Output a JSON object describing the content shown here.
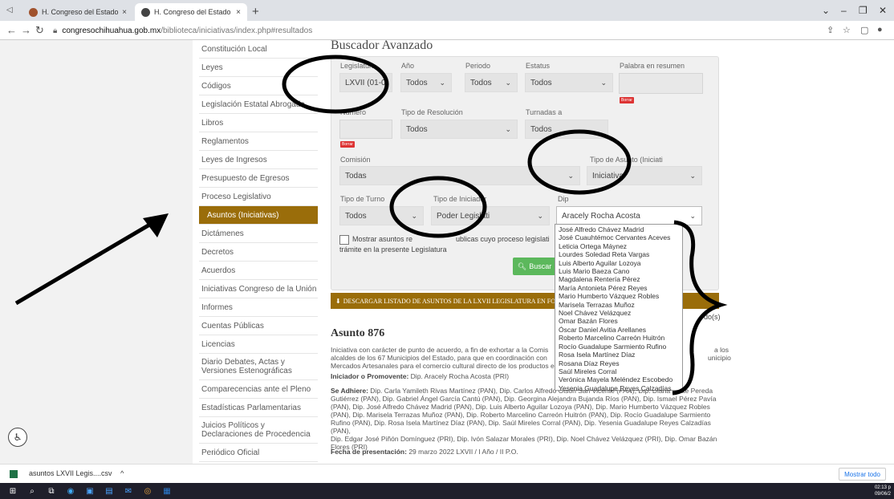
{
  "browser": {
    "tabs": [
      {
        "title": "H. Congreso del Estado de Chihu",
        "close": "×"
      },
      {
        "title": "H. Congreso del Estado de Chihu",
        "close": "×"
      }
    ],
    "new_tab": "+",
    "url_host": "congresochihuahua.gob.mx",
    "url_path": "/biblioteca/iniciativas/index.php#resultados"
  },
  "sidebar": {
    "items": [
      "Constitución Local",
      "Leyes",
      "Códigos",
      "Legislación Estatal Abrogada",
      "Libros",
      "Reglamentos",
      "Leyes de Ingresos",
      "Presupuesto de Egresos",
      "Proceso Legislativo",
      "Asuntos (Iniciativas)",
      "Dictámenes",
      "Decretos",
      "Acuerdos",
      "Iniciativas Congreso de la Unión",
      "Informes",
      "Cuentas Públicas",
      "Licencias",
      "Diario Debates, Actas y Versiones Estenográficas",
      "Comparecencias ante el Pleno",
      "Estadísticas Parlamentarias",
      "Juicios Políticos y Declaraciones de Procedencia",
      "Periódico Oficial"
    ]
  },
  "search": {
    "title": "Buscador Avanzado",
    "legislatura_label": "Legislatura",
    "legislatura_value": "LXVII (01-0",
    "anio_label": "Año",
    "anio_value": "Todos",
    "periodo_label": "Periodo",
    "periodo_value": "Todos",
    "estatus_label": "Estatus",
    "estatus_value": "Todos",
    "palabra_label": "Palabra en resumen",
    "borrar": "Borrar",
    "numero_label": "Número",
    "resolucion_label": "Tipo de Resolución",
    "resolucion_value": "Todos",
    "turnadas_label": "Turnadas a",
    "turnadas_value": "Todos",
    "comision_label": "Comisión",
    "comision_value": "Todas",
    "tipo_asunto_label": "Tipo de Asunto (Iniciati",
    "tipo_asunto_value": "Iniciativa",
    "tipo_turno_label": "Tipo de Turno",
    "tipo_turno_value": "Todos",
    "tipo_iniciador_label": "Tipo de Iniciador",
    "tipo_iniciador_value": "Poder Legislati",
    "diputado_label": "Dip",
    "diputado_value": "Aracely Rocha Acosta",
    "checkbox_text_a": "Mostrar asuntos re",
    "checkbox_text_b": "ublicas cuyo proceso legislati",
    "checkbox_text_c": "trámite en la presente Legislatura",
    "buscar": "Buscar"
  },
  "download_bar": {
    "label": "DESCARGAR LISTADO DE ASUNTOS DE LA LXVII LEGISLATURA EN FO"
  },
  "result_suffix": "do(s)",
  "dropdown_options": [
    "José Alfredo Chávez Madrid",
    "José Cuauhtémoc Cervantes Aceves",
    "Leticia Ortega Máynez",
    "Lourdes Soledad Reta Vargas",
    "Luis Alberto Aguilar Lozoya",
    "Luis Mario Baeza Cano",
    "Magdalena Rentería Pérez",
    "María Antonieta Pérez Reyes",
    "Mario Humberto Vázquez Robles",
    "Marisela Terrazas Muñoz",
    "Noel Chávez Velázquez",
    "Omar Bazán Flores",
    "Óscar Daniel Avitia Arellanes",
    "Roberto Marcelino Carreón Huitrón",
    "Rocío Guadalupe Sarmiento Rufino",
    "Rosa Isela Martínez Díaz",
    "Rosana Díaz Reyes",
    "Saúl Mireles Corral",
    "Verónica Mayela Meléndez Escobedo",
    "Yesenia Guadalupe Reyes Calzadías"
  ],
  "asunto": {
    "title": "Asunto 876",
    "desc_1": "Iniciativa con carácter de punto de acuerdo, a fin de exhortar a la Comis",
    "desc_1_tail": "a los",
    "desc_2": "alcaldes de los 67 Municipios del Estado, para que en coordinación con",
    "desc_2_tail": "unicipio",
    "desc_3": "Mercados Artesanales para el comercio cultural directo de los productos el",
    "iniciador_label": "Iniciador o Promovente:",
    "iniciador_value": "Dip. Aracely Rocha Acosta (PRI)",
    "adhiere_label": "Se Adhiere:",
    "adhiere_1": "Dip. Carla Yamileth Rivas Martínez (PAN), Dip. Carlos Alfredo Olson San Vicente (PAN), Dip. Diana Ivette Pereda",
    "adhiere_2": "Gutiérrez (PAN), Dip. Gabriel Ángel García Cantú (PAN), Dip. Georgina Alejandra Bujanda Ríos (PAN), Dip. Ismael Pérez Pavía",
    "adhiere_3": "(PAN), Dip. José Alfredo Chávez Madrid (PAN), Dip. Luis Alberto Aguilar Lozoya (PAN), Dip. Mario Humberto Vázquez Robles",
    "adhiere_4": "(PAN), Dip. Marisela Terrazas Muñoz (PAN), Dip. Roberto Marcelino Carreón Huitrón (PAN), Dip. Rocío Guadalupe Sarmiento",
    "adhiere_5": "Rufino (PAN), Dip. Rosa Isela Martínez Díaz (PAN), Dip. Saúl Mireles Corral (PAN), Dip. Yesenia Guadalupe Reyes Calzadías (PAN),",
    "adhiere_6": "Dip. Edgar José Piñón Domínguez (PRI), Dip. Ivón Salazar Morales (PRI), Dip. Noel Chávez Velázquez (PRI), Dip. Omar Bazán",
    "adhiere_7": "Flores (PRI)",
    "fecha_label": "Fecha de presentación:",
    "fecha_value": "29 marzo 2022   LXVII / I Año / II P.O."
  },
  "downloads": {
    "file": "asuntos LXVII Legis....csv",
    "chevron": "^",
    "show_all": "Mostrar todo"
  },
  "clock": {
    "time": "02:13 p",
    "date": "09/06/2"
  },
  "colors": {
    "accent": "#9a6d0a",
    "button": "#5cb85c",
    "borrar": "#dd3333"
  }
}
